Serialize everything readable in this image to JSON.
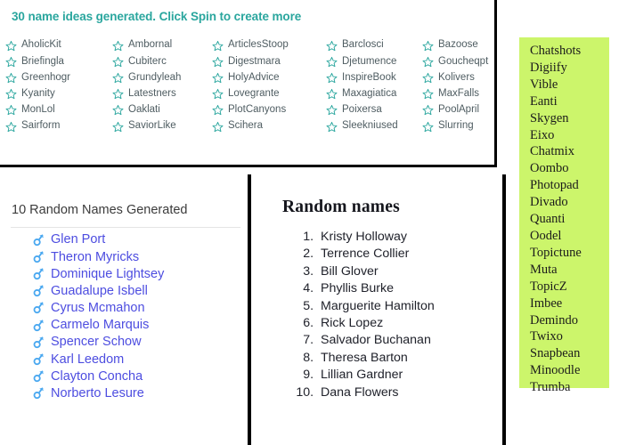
{
  "colors": {
    "teal": "#2aa69e",
    "idea_text": "#4e5c61",
    "male_name": "#4d4de0",
    "male_icon": "#4aa8f0",
    "green_bg": "#ccf56b",
    "panel_border": "#000000"
  },
  "ideas_panel": {
    "heading": "30 name ideas generated. Click Spin to create more",
    "star_icon": "star-outline-icon",
    "names": [
      "AholicKit",
      "Ambornal",
      "ArticlesStoop",
      "Barclosci",
      "Bazoose",
      "Briefingla",
      "Cubiterc",
      "Digestmara",
      "Djetumence",
      "Goucheqpt",
      "Greenhogr",
      "Grundyleah",
      "HolyAdvice",
      "InspireBook",
      "Kolivers",
      "Kyanity",
      "Latestners",
      "Lovegrante",
      "Maxagiatica",
      "MaxFalls",
      "MonLol",
      "Oaklati",
      "PlotCanyons",
      "Poixersa",
      "PoolApril",
      "Sairform",
      "SaviorLike",
      "Scihera",
      "Sleekniused",
      "Slurring"
    ]
  },
  "male_panel": {
    "title": "10 Random Names Generated",
    "gender_icon": "male-symbol-icon",
    "names": [
      "Glen Port",
      "Theron Myricks",
      "Dominique Lightsey",
      "Guadalupe Isbell",
      "Cyrus Mcmahon",
      "Carmelo Marquis",
      "Spencer Schow",
      "Karl Leedom",
      "Clayton Concha",
      "Norberto Lesure"
    ]
  },
  "numbered_panel": {
    "title": "Random names",
    "names": [
      "Kristy Holloway",
      "Terrence Collier",
      "Bill Glover",
      "Phyllis Burke",
      "Marguerite Hamilton",
      "Rick Lopez",
      "Salvador Buchanan",
      "Theresa Barton",
      "Lillian Gardner",
      "Dana Flowers"
    ]
  },
  "green_panel": {
    "names": [
      "Chatshots",
      "Digiify",
      "Vible",
      "Eanti",
      "Skygen",
      "Eixo",
      "Chatmix",
      "Oombo",
      "Photopad",
      "Divado",
      "Quanti",
      "Oodel",
      "Topictune",
      "Muta",
      "TopicZ",
      "Imbee",
      "Demindo",
      "Twixo",
      "Snapbean",
      "Minoodle",
      "Trumba"
    ]
  }
}
